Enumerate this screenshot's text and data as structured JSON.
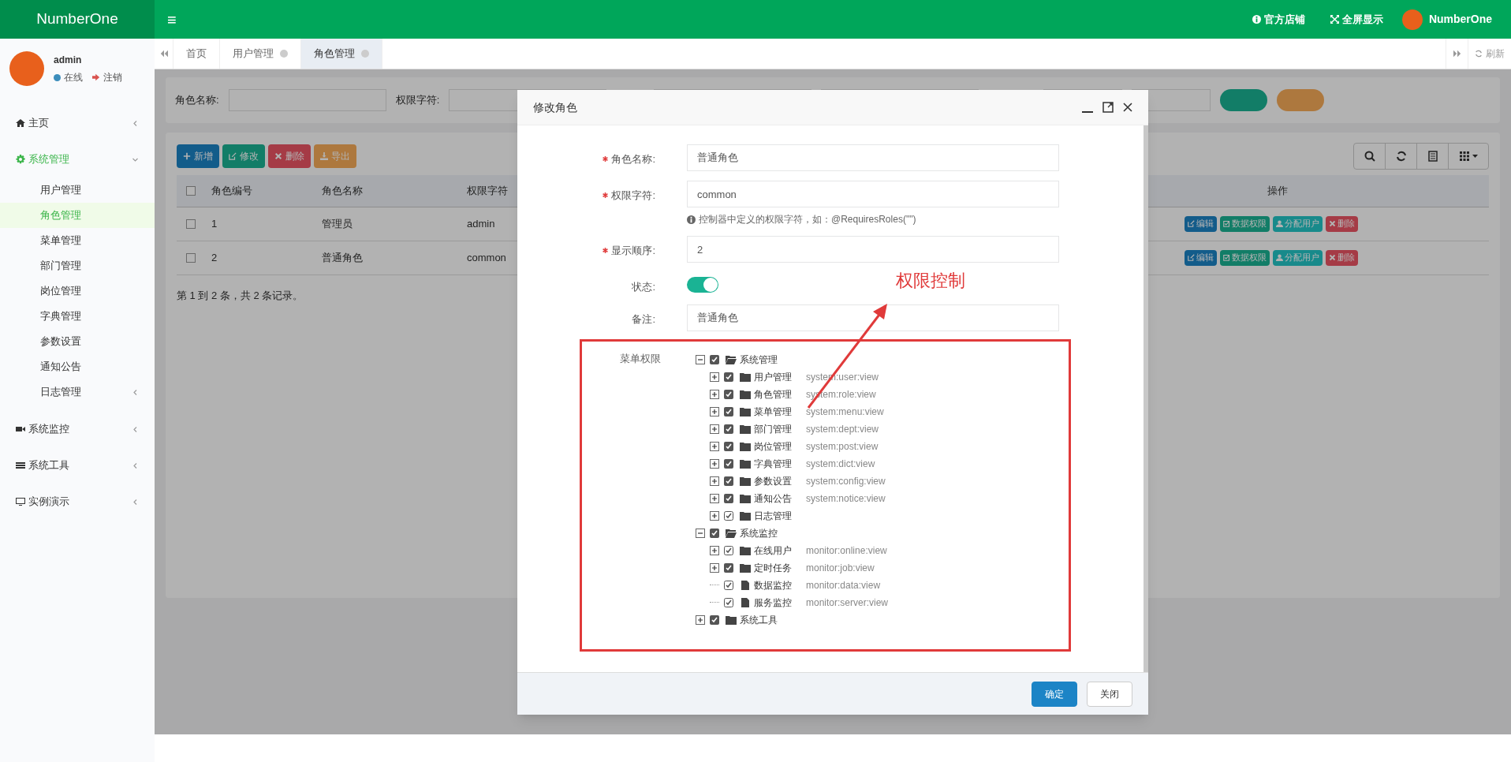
{
  "header": {
    "logo": "NumberOne",
    "menu_icon": "≡",
    "links": [
      {
        "kind": "info",
        "label": "官方店铺"
      },
      {
        "kind": "expand",
        "label": "全屏显示"
      }
    ],
    "user": "NumberOne"
  },
  "sidebar": {
    "user": {
      "name": "admin",
      "status": "在线",
      "logout": "注销"
    },
    "items": [
      {
        "label": "主页",
        "expanded": false,
        "selected": false
      },
      {
        "label": "系统管理",
        "expanded": true,
        "selected": true,
        "children": [
          {
            "label": "用户管理",
            "selected": false,
            "has_children": false
          },
          {
            "label": "角色管理",
            "selected": true,
            "has_children": false
          },
          {
            "label": "菜单管理",
            "selected": false,
            "has_children": false
          },
          {
            "label": "部门管理",
            "selected": false,
            "has_children": false
          },
          {
            "label": "岗位管理",
            "selected": false,
            "has_children": false
          },
          {
            "label": "字典管理",
            "selected": false,
            "has_children": false
          },
          {
            "label": "参数设置",
            "selected": false,
            "has_children": false
          },
          {
            "label": "通知公告",
            "selected": false,
            "has_children": false
          },
          {
            "label": "日志管理",
            "selected": false,
            "has_children": true
          }
        ]
      },
      {
        "label": "系统监控",
        "expanded": false,
        "selected": false
      },
      {
        "label": "系统工具",
        "expanded": false,
        "selected": false
      },
      {
        "label": "实例演示",
        "expanded": false,
        "selected": false
      }
    ]
  },
  "tabs": [
    {
      "label": "首页",
      "selected": false,
      "closable": false
    },
    {
      "label": "用户管理",
      "selected": false,
      "closable": true
    },
    {
      "label": "角色管理",
      "selected": true,
      "closable": true
    }
  ],
  "refresh": "刷新",
  "search": {
    "fields": [
      {
        "label": "角色名称:"
      },
      {
        "label": "权限字符:"
      }
    ]
  },
  "toolbar": [
    {
      "kind": "add",
      "label": "新增"
    },
    {
      "kind": "edit",
      "label": "修改"
    },
    {
      "kind": "delete",
      "label": "删除"
    },
    {
      "kind": "export",
      "label": "导出"
    }
  ],
  "table": {
    "columns": [
      "角色编号",
      "角色名称",
      "权限字符",
      "操作"
    ],
    "all_checked": false,
    "rows": [
      {
        "checked": false,
        "cells": [
          "1",
          "管理员",
          "admin"
        ],
        "actions": [
          {
            "kind": "edit",
            "label": "编辑"
          },
          {
            "kind": "data",
            "label": "数据权限"
          },
          {
            "kind": "assign",
            "label": "分配用户"
          },
          {
            "kind": "delete",
            "label": "删除"
          }
        ]
      },
      {
        "checked": false,
        "cells": [
          "2",
          "普通角色",
          "common"
        ],
        "actions": [
          {
            "kind": "edit",
            "label": "编辑"
          },
          {
            "kind": "data",
            "label": "数据权限"
          },
          {
            "kind": "assign",
            "label": "分配用户"
          },
          {
            "kind": "delete",
            "label": "删除"
          }
        ]
      }
    ],
    "footer": "第 1 到 2 条，共 2 条记录。"
  },
  "modal": {
    "title": "修改角色",
    "fields": [
      {
        "kind": "text",
        "label": "角色名称:",
        "required": true,
        "value": "普通角色"
      },
      {
        "kind": "text",
        "label": "权限字符:",
        "required": true,
        "value": "common",
        "hint": "控制器中定义的权限字符，如：@RequiresRoles(\"\")"
      },
      {
        "kind": "text",
        "label": "显示顺序:",
        "required": true,
        "value": "2"
      },
      {
        "kind": "switch",
        "label": "状态:",
        "required": false,
        "on": true
      },
      {
        "kind": "text",
        "label": "备注:",
        "required": false,
        "value": "普通角色"
      }
    ],
    "tree_label": "菜单权限",
    "tree": [
      {
        "label": "系统管理",
        "kind": "folder",
        "expanded": true,
        "checked": true,
        "partial": false,
        "children": [
          {
            "label": "用户管理",
            "kind": "folder",
            "expanded": false,
            "checked": true,
            "partial": false,
            "perm": "system:user:view"
          },
          {
            "label": "角色管理",
            "kind": "folder",
            "expanded": false,
            "checked": true,
            "partial": false,
            "perm": "system:role:view"
          },
          {
            "label": "菜单管理",
            "kind": "folder",
            "expanded": false,
            "checked": true,
            "partial": false,
            "perm": "system:menu:view"
          },
          {
            "label": "部门管理",
            "kind": "folder",
            "expanded": false,
            "checked": true,
            "partial": false,
            "perm": "system:dept:view"
          },
          {
            "label": "岗位管理",
            "kind": "folder",
            "expanded": false,
            "checked": true,
            "partial": false,
            "perm": "system:post:view"
          },
          {
            "label": "字典管理",
            "kind": "folder",
            "expanded": false,
            "checked": true,
            "partial": false,
            "perm": "system:dict:view"
          },
          {
            "label": "参数设置",
            "kind": "folder",
            "expanded": false,
            "checked": true,
            "partial": false,
            "perm": "system:config:view"
          },
          {
            "label": "通知公告",
            "kind": "folder",
            "expanded": false,
            "checked": true,
            "partial": false,
            "perm": "system:notice:view"
          },
          {
            "label": "日志管理",
            "kind": "folder",
            "expanded": false,
            "checked": true,
            "partial": true
          }
        ]
      },
      {
        "label": "系统监控",
        "kind": "folder",
        "expanded": true,
        "checked": true,
        "partial": false,
        "children": [
          {
            "label": "在线用户",
            "kind": "folder",
            "expanded": false,
            "checked": true,
            "partial": true,
            "perm": "monitor:online:view"
          },
          {
            "label": "定时任务",
            "kind": "folder",
            "expanded": false,
            "checked": true,
            "partial": false,
            "perm": "monitor:job:view"
          },
          {
            "label": "数据监控",
            "kind": "file",
            "checked": true,
            "partial": true,
            "perm": "monitor:data:view"
          },
          {
            "label": "服务监控",
            "kind": "file",
            "checked": true,
            "partial": true,
            "perm": "monitor:server:view"
          }
        ]
      },
      {
        "label": "系统工具",
        "kind": "folder",
        "expanded": false,
        "checked": true,
        "partial": false
      }
    ],
    "buttons": [
      {
        "kind": "primary",
        "label": "确定"
      },
      {
        "kind": "default",
        "label": "关闭"
      }
    ]
  },
  "annotation": {
    "text": "权限控制"
  }
}
